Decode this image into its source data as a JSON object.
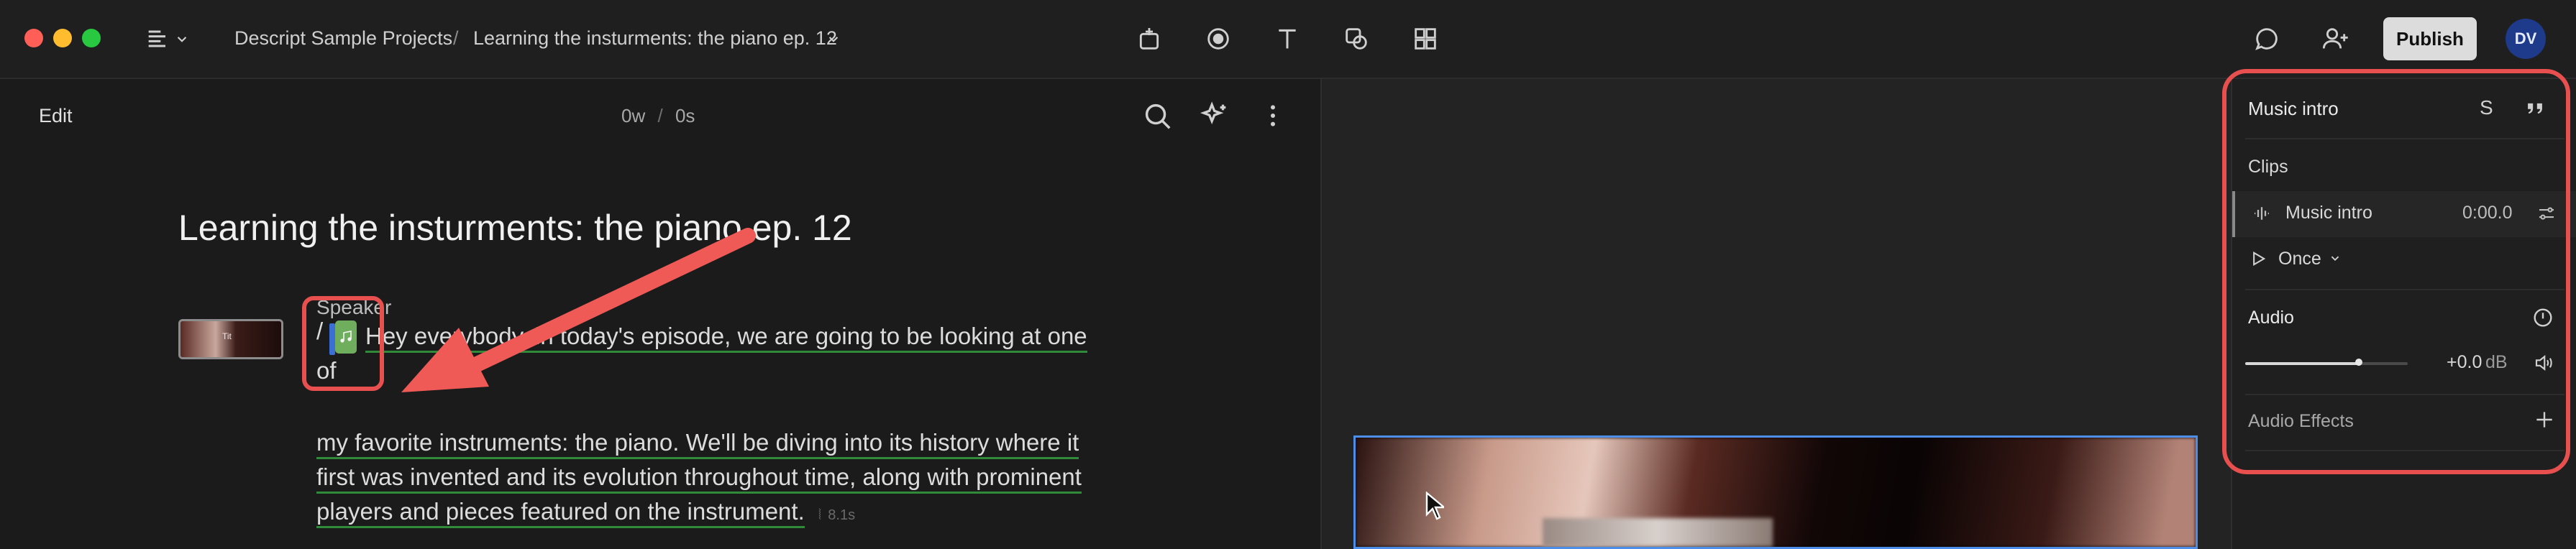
{
  "titlebar": {
    "project_name": "Descript Sample Projects",
    "separator": "/",
    "composition_name": "Learning the insturments: the piano ep. 12",
    "publish_label": "Publish",
    "avatar_initials": "DV",
    "icons": [
      "menu-icon",
      "chevron-down-icon",
      "add-scene-icon",
      "record-icon",
      "text-icon",
      "shapes-icon",
      "grid-icon",
      "comment-icon",
      "add-user-icon"
    ]
  },
  "script": {
    "mode_label": "Edit",
    "duration_words": "0w",
    "duration_sep": "/",
    "duration_secs": "0s",
    "title": "Learning the insturments: the piano ep. 12",
    "speaker_label": "Speaker",
    "slash": "/",
    "line1": "Hey everybody, in today's episode, we are going to be looking at one",
    "line1b": "of",
    "para2_line1": "my favorite instruments: the piano. We'll be diving into its history where it",
    "para2_line2": "first was invented and its evolution throughout time, along with prominent",
    "para2_line3": "players and pieces featured on the instrument.",
    "gap_label": "8.1s"
  },
  "properties": {
    "layer_name": "Music intro",
    "layer_key": "S",
    "clips_heading": "Clips",
    "clip_name": "Music intro",
    "clip_time": "0:00.0",
    "loop_label": "Once",
    "audio_heading": "Audio",
    "volume_value": 0.7,
    "volume_db": "+0.0",
    "volume_unit": "dB",
    "effects_heading": "Audio Effects"
  },
  "annotations": {
    "highlight_color": "#e8504f",
    "arrow_color": "#f05a56"
  }
}
